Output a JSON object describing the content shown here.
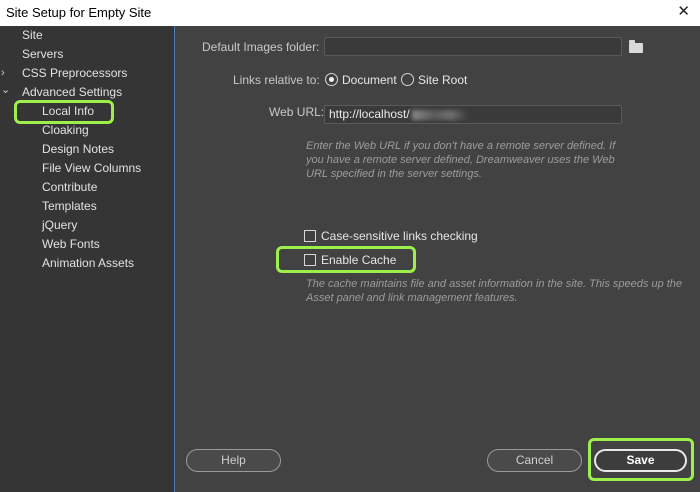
{
  "window": {
    "title": "Site Setup for Empty Site",
    "close_glyph": "✕"
  },
  "sidebar": {
    "items": [
      {
        "label": "Site",
        "arrow": ""
      },
      {
        "label": "Servers",
        "arrow": ""
      },
      {
        "label": "CSS Preprocessors",
        "arrow": "›"
      },
      {
        "label": "Advanced Settings",
        "arrow": "⌄"
      },
      {
        "label": "Local Info",
        "arrow": ""
      },
      {
        "label": "Cloaking",
        "arrow": ""
      },
      {
        "label": "Design Notes",
        "arrow": ""
      },
      {
        "label": "File View Columns",
        "arrow": ""
      },
      {
        "label": "Contribute",
        "arrow": ""
      },
      {
        "label": "Templates",
        "arrow": ""
      },
      {
        "label": "jQuery",
        "arrow": ""
      },
      {
        "label": "Web Fonts",
        "arrow": ""
      },
      {
        "label": "Animation Assets",
        "arrow": ""
      }
    ],
    "selected": "Local Info"
  },
  "main": {
    "default_images_label": "Default Images folder:",
    "default_images_value": "",
    "links_relative_label": "Links relative to:",
    "radio_document": "Document",
    "radio_site_root": "Site Root",
    "selected_link_mode": "Document",
    "web_url_label": "Web URL:",
    "web_url_value": "http://localhost/",
    "web_url_help": "Enter the Web URL if you don't have a remote server defined. If you have a remote server defined, Dreamweaver uses the Web URL specified in the server settings.",
    "case_sensitive_label": "Case-sensitive links checking",
    "case_sensitive_checked": false,
    "enable_cache_label": "Enable Cache",
    "enable_cache_checked": false,
    "cache_help": "The cache maintains file and asset information in the site. This speeds up the Asset panel and link management features."
  },
  "footer": {
    "help_label": "Help",
    "cancel_label": "Cancel",
    "save_label": "Save"
  },
  "colors": {
    "highlight": "#9df04a",
    "panel": "#424242",
    "sidebar": "#353535"
  }
}
